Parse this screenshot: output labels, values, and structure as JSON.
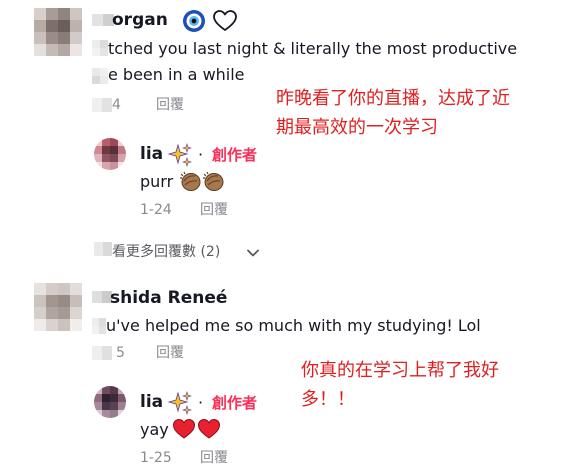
{
  "comments": [
    {
      "username": "organ",
      "badges": [
        "nazar-amulet-icon",
        "white-heart-icon"
      ],
      "text_line1": "tched you last night & literally the most productive",
      "text_line2": "e been in a while",
      "date": "4",
      "reply_label": "回覆",
      "reply": {
        "username": "lia",
        "badge": "sparkles-icon",
        "dot": "·",
        "creator_label": "創作者",
        "text": "purr",
        "emoji": [
          "clapping-hands-icon",
          "clapping-hands-icon"
        ],
        "date": "1-24",
        "reply_label": "回覆"
      },
      "view_more": "看更多回覆數 (2)"
    },
    {
      "username": "shida Reneé",
      "text": "u've helped me so much with my studying! Lol",
      "date": "5",
      "reply_label": "回覆",
      "reply": {
        "username": "lia",
        "badge": "sparkles-icon",
        "dot": "·",
        "creator_label": "創作者",
        "text": "yay",
        "emoji": [
          "red-heart-icon",
          "red-heart-icon"
        ],
        "date": "1-25",
        "reply_label": "回覆"
      }
    }
  ],
  "annotations": {
    "first_line1": "昨晚看了你的直播，达成了近",
    "first_line2": "期最高效的一次学习",
    "second_line1": "你真的在学习上帮了我好",
    "second_line2": "多！！"
  },
  "colors": {
    "creator_red": "#fe2c55",
    "annotation_red": "#e02020",
    "meta_gray": "#8a8b91"
  }
}
